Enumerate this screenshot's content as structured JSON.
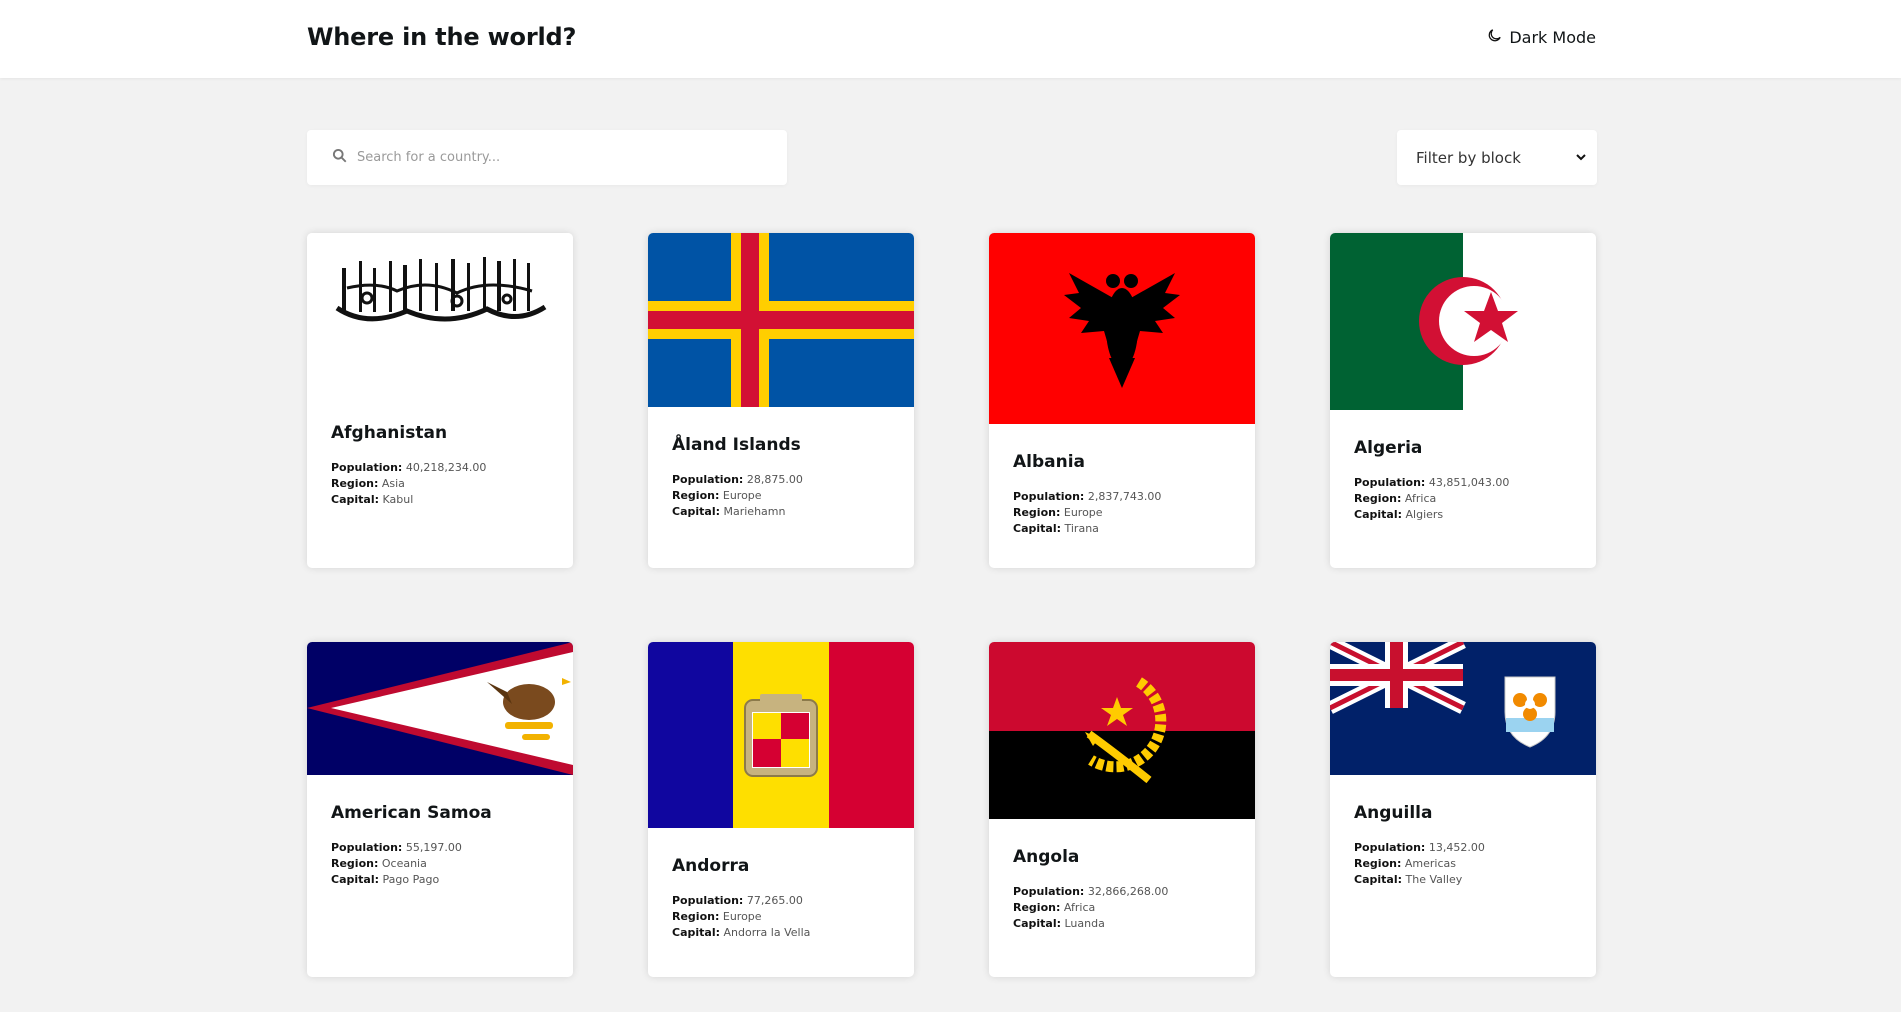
{
  "header": {
    "title": "Where in the world?",
    "dark_mode_label": "Dark Mode"
  },
  "search": {
    "placeholder": "Search for a country..."
  },
  "filter": {
    "selected": "Filter by block"
  },
  "labels": {
    "population": "Population:",
    "region": "Region:",
    "capital": "Capital:"
  },
  "countries": [
    {
      "name": "Afghanistan",
      "population": "40,218,234.00",
      "region": "Asia",
      "capital": "Kabul",
      "flag_icon": "afghanistan-flag"
    },
    {
      "name": "Åland Islands",
      "population": "28,875.00",
      "region": "Europe",
      "capital": "Mariehamn",
      "flag_icon": "aland-islands-flag"
    },
    {
      "name": "Albania",
      "population": "2,837,743.00",
      "region": "Europe",
      "capital": "Tirana",
      "flag_icon": "albania-flag"
    },
    {
      "name": "Algeria",
      "population": "43,851,043.00",
      "region": "Africa",
      "capital": "Algiers",
      "flag_icon": "algeria-flag"
    },
    {
      "name": "American Samoa",
      "population": "55,197.00",
      "region": "Oceania",
      "capital": "Pago Pago",
      "flag_icon": "american-samoa-flag"
    },
    {
      "name": "Andorra",
      "population": "77,265.00",
      "region": "Europe",
      "capital": "Andorra la Vella",
      "flag_icon": "andorra-flag"
    },
    {
      "name": "Angola",
      "population": "32,866,268.00",
      "region": "Africa",
      "capital": "Luanda",
      "flag_icon": "angola-flag"
    },
    {
      "name": "Anguilla",
      "population": "13,452.00",
      "region": "Americas",
      "capital": "The Valley",
      "flag_icon": "anguilla-flag"
    }
  ],
  "colors": {
    "background": "#f2f2f2",
    "card": "#ffffff",
    "text": "#111517"
  }
}
